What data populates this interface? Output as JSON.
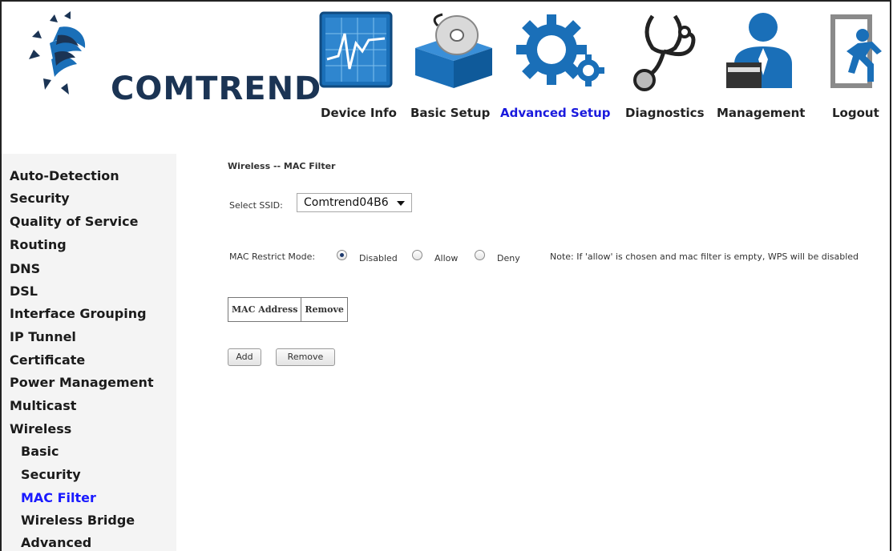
{
  "brand": {
    "name": "COMTREND"
  },
  "nav": {
    "device_info": "Device Info",
    "basic_setup": "Basic Setup",
    "advanced_setup": "Advanced Setup",
    "diagnostics": "Diagnostics",
    "management": "Management",
    "logout": "Logout"
  },
  "sidebar": {
    "items": [
      "Auto-Detection",
      "Security",
      "Quality of Service",
      "Routing",
      "DNS",
      "DSL",
      "Interface Grouping",
      "IP Tunnel",
      "Certificate",
      "Power Management",
      "Multicast",
      "Wireless",
      "Basic",
      "Security",
      "MAC Filter",
      "Wireless Bridge",
      "Advanced"
    ]
  },
  "main": {
    "title": "Wireless -- MAC Filter",
    "select_ssid_label": "Select SSID:",
    "ssid_value": "Comtrend04B6",
    "mac_restrict_label": "MAC Restrict Mode:",
    "modes": [
      "Disabled",
      "Allow",
      "Deny"
    ],
    "selected_mode": "Disabled",
    "note": "Note: If 'allow' is chosen and mac filter is empty, WPS will be disabled",
    "table_headers": [
      "MAC Address",
      "Remove"
    ],
    "add_button": "Add",
    "remove_button": "Remove"
  },
  "colors": {
    "active_nav": "#1a1add",
    "active_sidebar": "#1a1aff",
    "brand_dark": "#1b3454",
    "icon_blue": "#1a6fb8"
  }
}
